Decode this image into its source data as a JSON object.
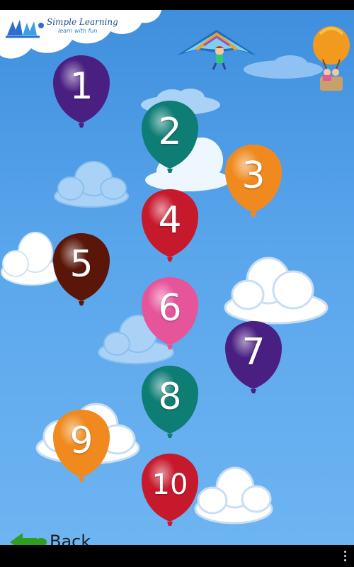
{
  "app": {
    "logo_title": "Simple Learning",
    "logo_tagline": "learn with fun"
  },
  "balloons": [
    {
      "label": "1",
      "color": "#4a1f82"
    },
    {
      "label": "2",
      "color": "#0e7d74"
    },
    {
      "label": "3",
      "color": "#f08a1e"
    },
    {
      "label": "4",
      "color": "#c7192c"
    },
    {
      "label": "5",
      "color": "#5a1608"
    },
    {
      "label": "6",
      "color": "#e6559a"
    },
    {
      "label": "7",
      "color": "#4a1f82"
    },
    {
      "label": "8",
      "color": "#0e7d74"
    },
    {
      "label": "9",
      "color": "#f08a1e"
    },
    {
      "label": "10",
      "color": "#c7192c"
    }
  ],
  "footer": {
    "back_label": "Back"
  },
  "colors": {
    "sky_top": "#3f8fde",
    "sky_bottom": "#6db4f2",
    "back_arrow": "#2f9e1e"
  }
}
